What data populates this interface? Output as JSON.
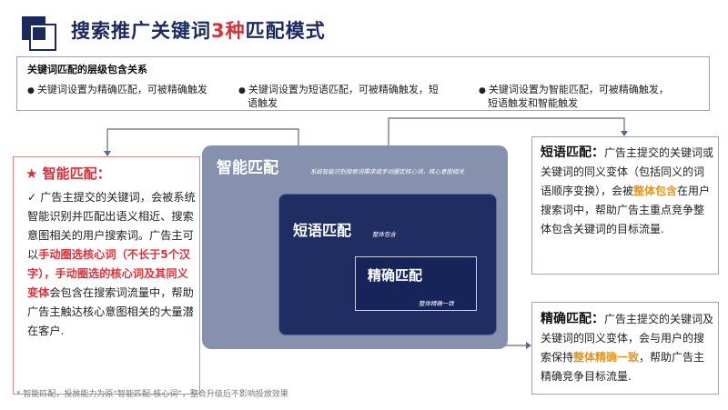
{
  "title": {
    "part1": "搜索推广关键词",
    "highlight": "3种",
    "part2": "匹配模式"
  },
  "hierarchy": {
    "title": "关键词匹配的层级包含关系",
    "bullets": [
      "关键词设置为精确匹配，可被精确触发",
      "关键词设置为短语匹配，可被精确触发，短",
      "语触发",
      "关键词设置为智能匹配，可被精确触发，",
      "短语触发和智能触发"
    ]
  },
  "smart_card": {
    "heading": "★ 智能匹配：",
    "check": "✓",
    "text1": "广告主提交的关键词，会被系统智能识别并匹配出语义相近、搜索意图相关的用户搜索词。广告主可以",
    "red1": "手动圈选核心词（不长于5个汉字），手动圈选的核心词及其同义",
    "orange1": "变体",
    "text2": "会包含在搜索词流量中，帮助广告主触达核心意图相关的大量潜在客户.",
    "footnote": "* 智能匹配，投放能力为原“智能匹配-核心词”，整合升级后不影响投放效果"
  },
  "diagram": {
    "smart_title": "智能匹配",
    "smart_sub": "系统智能识别搜索词需求或手动圈定核心词，核心意图相关",
    "phrase_title": "短语匹配",
    "phrase_sub": "整体包含",
    "exact_title": "精确匹配",
    "exact_sub": "整体精确一致"
  },
  "phrase_card": {
    "heading": "短语匹配：",
    "text1": "广告主提交的关键词或关键词的同义变体（包括同义的词语顺序变换），会被",
    "orange": "整体包含",
    "text2": "在用户搜索词中，帮助广告主重点竞争整体包含关键词的目标流量."
  },
  "exact_card": {
    "heading": "精确匹配：",
    "text1": "广告主提交的关键词及关键词的同义变体，会与用户的搜索保持",
    "orange": "整体精确一致",
    "text2": "，帮助广告主精确竞争目标流量."
  },
  "colors": {
    "navy": "#1a2a5e",
    "red": "#d6303a",
    "orange": "#e8961a",
    "slate": "#8591ad"
  }
}
